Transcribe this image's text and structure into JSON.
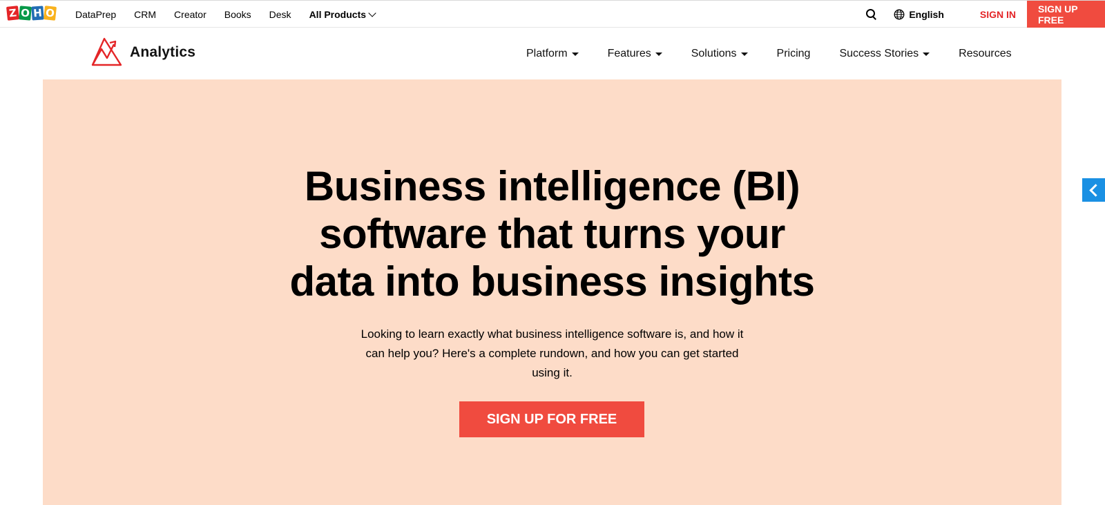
{
  "topbar": {
    "logo_letters": [
      "Z",
      "O",
      "H",
      "O"
    ],
    "links": [
      "DataPrep",
      "CRM",
      "Creator",
      "Books",
      "Desk"
    ],
    "all_products": "All Products",
    "language": "English",
    "sign_in": "SIGN IN",
    "sign_up": "SIGN UP FREE"
  },
  "product_nav": {
    "brand": "Analytics",
    "items": [
      {
        "label": "Platform",
        "has_dropdown": true
      },
      {
        "label": "Features",
        "has_dropdown": true
      },
      {
        "label": "Solutions",
        "has_dropdown": true
      },
      {
        "label": "Pricing",
        "has_dropdown": false
      },
      {
        "label": "Success Stories",
        "has_dropdown": true
      },
      {
        "label": "Resources",
        "has_dropdown": false
      }
    ]
  },
  "hero": {
    "title_lines": [
      "Business intelligence (BI)",
      "software that turns your",
      "data into business insights"
    ],
    "description": "Looking to learn exactly what business intelligence software is, and how it can help you? Here's a complete rundown, and how you can get started using it.",
    "cta": "SIGN UP FOR FREE"
  },
  "colors": {
    "accent_red": "#f04b3f",
    "hero_bg": "#fddcc8",
    "side_tab_blue": "#1a90e3"
  }
}
